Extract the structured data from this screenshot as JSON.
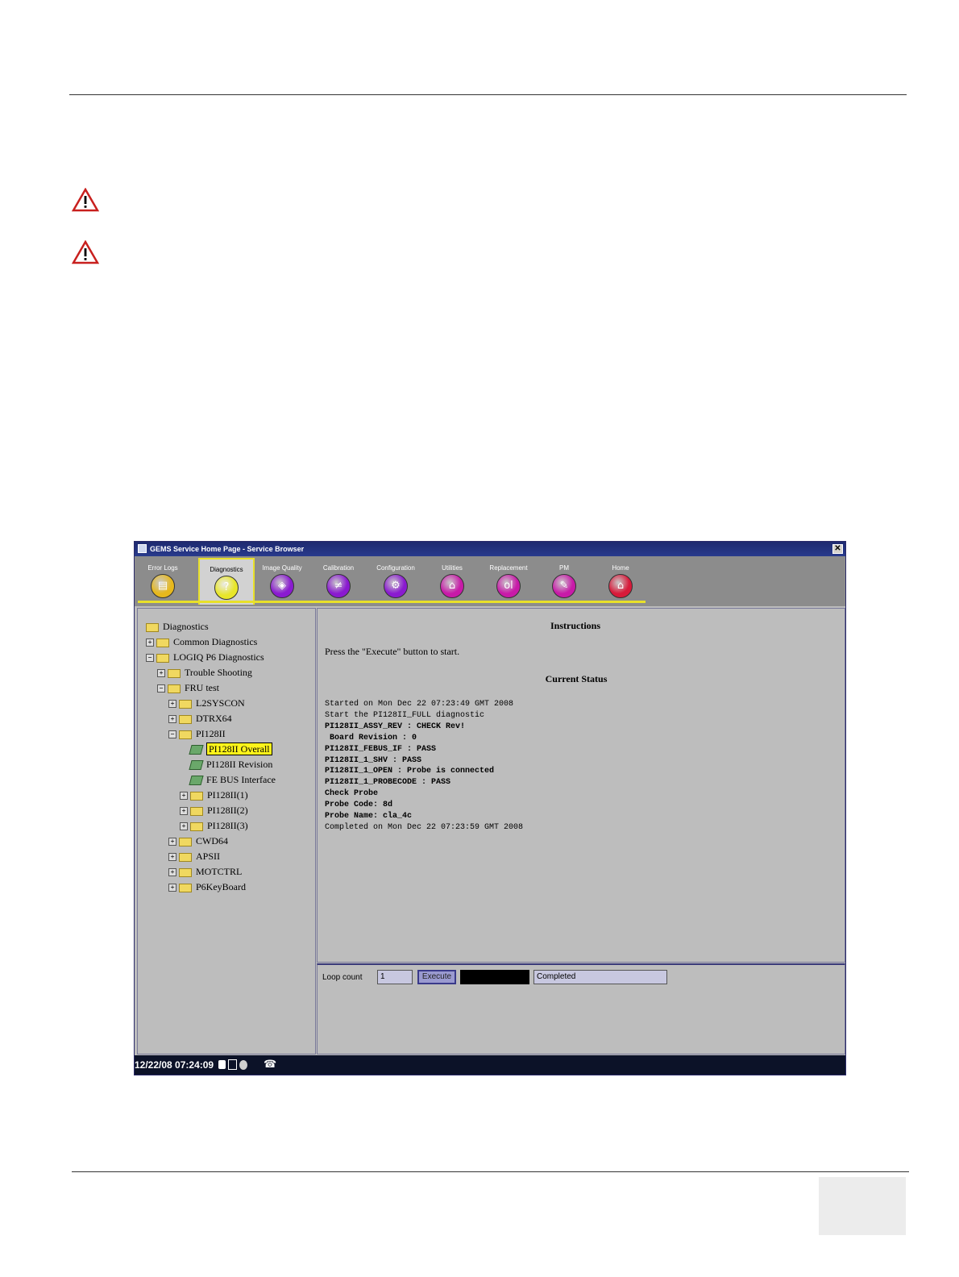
{
  "window": {
    "title": "GEMS Service Home Page - Service Browser",
    "close_glyph": "✕"
  },
  "toolbar": {
    "tabs": [
      {
        "label": "Error Logs",
        "icon": "error-logs-icon",
        "color": "#e7b81c",
        "glyph": "▤",
        "active": false
      },
      {
        "label": "Diagnostics",
        "icon": "diagnostics-icon",
        "color": "#e8e62a",
        "glyph": "?",
        "active": true
      },
      {
        "label": "Image Quality",
        "icon": "image-quality-icon",
        "color": "#8a1ad0",
        "glyph": "◈",
        "active": false
      },
      {
        "label": "Calibration",
        "icon": "calibration-icon",
        "color": "#8a1ad0",
        "glyph": "≠",
        "active": false
      },
      {
        "label": "Configuration",
        "icon": "configuration-icon",
        "color": "#8a1ad0",
        "glyph": "⚙",
        "active": false
      },
      {
        "label": "Utilities",
        "icon": "utilities-icon",
        "color": "#c81aa8",
        "glyph": "⌂",
        "active": false
      },
      {
        "label": "Replacement",
        "icon": "replacement-icon",
        "color": "#c81aa8",
        "glyph": "ol",
        "active": false
      },
      {
        "label": "PM",
        "icon": "pm-icon",
        "color": "#c81aa8",
        "glyph": "✎",
        "active": false
      },
      {
        "label": "Home",
        "icon": "home-icon",
        "color": "#d81a3a",
        "glyph": "⌂",
        "active": false
      }
    ]
  },
  "tree": {
    "items": [
      {
        "label": "Diagnostics",
        "level": 0,
        "type": "folder-open",
        "expander": ""
      },
      {
        "label": "Common Diagnostics",
        "level": 0,
        "type": "folder",
        "expander": "+"
      },
      {
        "label": "LOGIQ P6 Diagnostics",
        "level": 0,
        "type": "folder-open",
        "expander": "−"
      },
      {
        "label": "Trouble Shooting",
        "level": 1,
        "type": "folder",
        "expander": "+"
      },
      {
        "label": "FRU test",
        "level": 1,
        "type": "folder-open",
        "expander": "−"
      },
      {
        "label": "L2SYSCON",
        "level": 2,
        "type": "folder",
        "expander": "+"
      },
      {
        "label": "DTRX64",
        "level": 2,
        "type": "folder",
        "expander": "+"
      },
      {
        "label": "PI128II",
        "level": 2,
        "type": "folder-open",
        "expander": "−"
      },
      {
        "label": "PI128II Overall",
        "level": 3,
        "type": "leaf",
        "expander": "",
        "selected": true
      },
      {
        "label": "PI128II Revision",
        "level": 3,
        "type": "leaf",
        "expander": ""
      },
      {
        "label": "FE BUS Interface",
        "level": 3,
        "type": "leaf",
        "expander": ""
      },
      {
        "label": "PI128II(1)",
        "level": 3,
        "type": "folder",
        "expander": "+"
      },
      {
        "label": "PI128II(2)",
        "level": 3,
        "type": "folder",
        "expander": "+"
      },
      {
        "label": "PI128II(3)",
        "level": 3,
        "type": "folder",
        "expander": "+"
      },
      {
        "label": "CWD64",
        "level": 2,
        "type": "folder",
        "expander": "+"
      },
      {
        "label": "APSII",
        "level": 2,
        "type": "folder",
        "expander": "+"
      },
      {
        "label": "MOTCTRL",
        "level": 2,
        "type": "folder",
        "expander": "+"
      },
      {
        "label": "P6KeyBoard",
        "level": 2,
        "type": "folder",
        "expander": "+"
      }
    ]
  },
  "main": {
    "instructions_heading": "Instructions",
    "instructions_text": "Press the \"Execute\" button to start.",
    "status_heading": "Current Status",
    "log": [
      {
        "text": "Started on Mon Dec 22 07:23:49 GMT 2008",
        "bold": false
      },
      {
        "text": "Start the PI128II_FULL diagnostic",
        "bold": false
      },
      {
        "text": "PI128II_ASSY_REV : CHECK Rev!",
        "bold": true
      },
      {
        "text": " Board Revision : 0",
        "bold": true
      },
      {
        "text": "PI128II_FEBUS_IF : PASS",
        "bold": true
      },
      {
        "text": "PI128II_1_SHV : PASS",
        "bold": true
      },
      {
        "text": "PI128II_1_OPEN : Probe is connected",
        "bold": true
      },
      {
        "text": "PI128II_1_PROBECODE : PASS",
        "bold": true
      },
      {
        "text": "Check Probe",
        "bold": true
      },
      {
        "text": "Probe Code: 8d",
        "bold": true
      },
      {
        "text": "Probe Name: cla_4c",
        "bold": true
      },
      {
        "text": "Completed on Mon Dec 22 07:23:59 GMT 2008",
        "bold": false
      }
    ]
  },
  "controls": {
    "loop_count_label": "Loop count",
    "loop_count_value": "1",
    "execute_label": "Execute",
    "status_value": "Completed"
  },
  "statusbar": {
    "datetime": "12/22/08 07:24:09",
    "icons": [
      "lock-icon",
      "network-icon",
      "disc-icon",
      "phone-icon"
    ]
  },
  "colors": {
    "warning": "#c8201e",
    "selection": "#fff41a",
    "tab_underline": "#e8e02a"
  }
}
